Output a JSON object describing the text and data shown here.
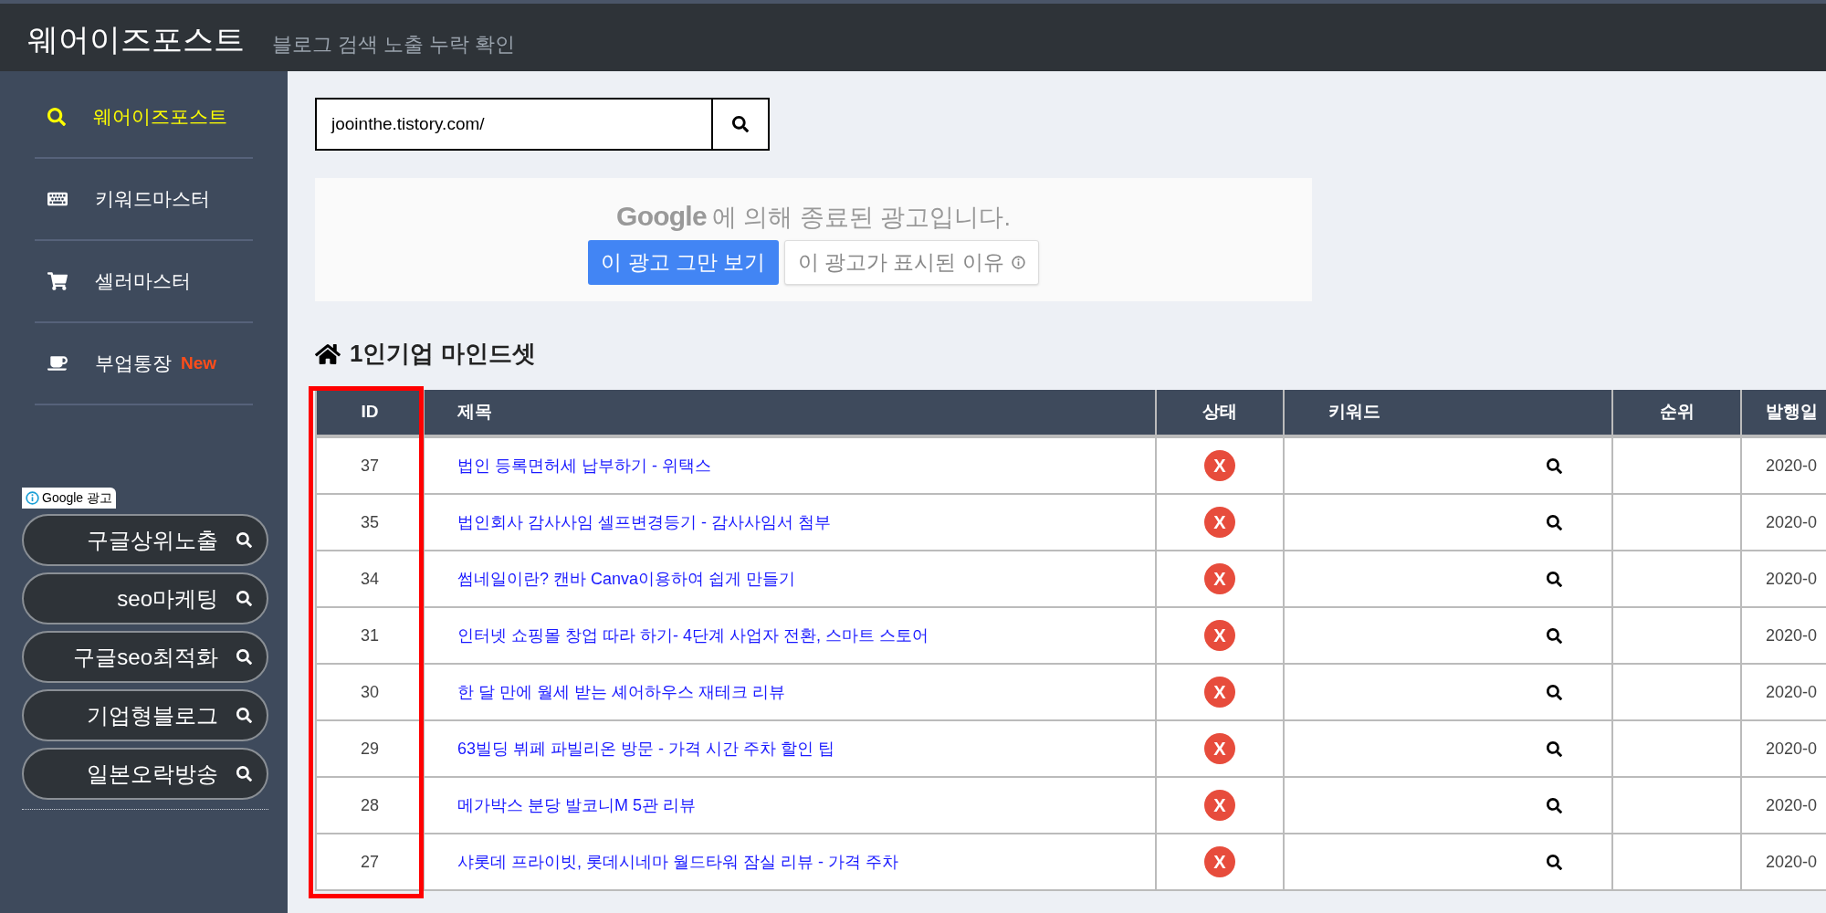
{
  "header": {
    "title": "웨어이즈포스트",
    "subtitle": "블로그 검색 노출 누락 확인"
  },
  "sidebar": {
    "items": [
      {
        "label": "웨어이즈포스트",
        "selected": true
      },
      {
        "label": "키워드마스터",
        "selected": false
      },
      {
        "label": "셀러마스터",
        "selected": false
      },
      {
        "label": "부업통장",
        "selected": false,
        "badge": "New"
      }
    ],
    "ad_label": "Google 광고",
    "ad_links": [
      "구글상위노출",
      "seo마케팅",
      "구글seo최적화",
      "기업형블로그",
      "일본오락방송"
    ]
  },
  "search": {
    "value": "joointhe.tistory.com/"
  },
  "ad_notice": {
    "brand": "Google",
    "message": "에 의해 종료된 광고입니다.",
    "stop_button": "이 광고 그만 보기",
    "why_button": "이 광고가 표시된 이유"
  },
  "section_title": "1인기업 마인드셋",
  "table": {
    "columns": [
      "ID",
      "제목",
      "상태",
      "키워드",
      "순위",
      "발행일"
    ],
    "rows": [
      {
        "id": "37",
        "title": "법인 등록면허세 납부하기 - 위택스",
        "status_text": "X",
        "date": "2020-0"
      },
      {
        "id": "35",
        "title": "법인회사 감사사임 셀프변경등기 - 감사사임서 첨부",
        "status_text": "X",
        "date": "2020-0"
      },
      {
        "id": "34",
        "title": "썸네일이란? 캔바 Canva이용하여 쉽게 만들기",
        "status_text": "X",
        "date": "2020-0"
      },
      {
        "id": "31",
        "title": "인터넷 쇼핑몰 창업 따라 하기- 4단계 사업자 전환, 스마트 스토어",
        "status_text": "X",
        "date": "2020-0"
      },
      {
        "id": "30",
        "title": "한 달 만에 월세 받는 셰어하우스 재테크 리뷰",
        "status_text": "X",
        "date": "2020-0"
      },
      {
        "id": "29",
        "title": "63빌딩 뷔페 파빌리온 방문 - 가격 시간 주차 할인 팁",
        "status_text": "X",
        "date": "2020-0"
      },
      {
        "id": "28",
        "title": "메가박스 분당 발코니M 5관 리뷰",
        "status_text": "X",
        "date": "2020-0"
      },
      {
        "id": "27",
        "title": "샤롯데 프라이빗, 롯데시네마 월드타워 잠실 리뷰 - 가격 주차",
        "status_text": "X",
        "date": "2020-0"
      }
    ]
  }
}
